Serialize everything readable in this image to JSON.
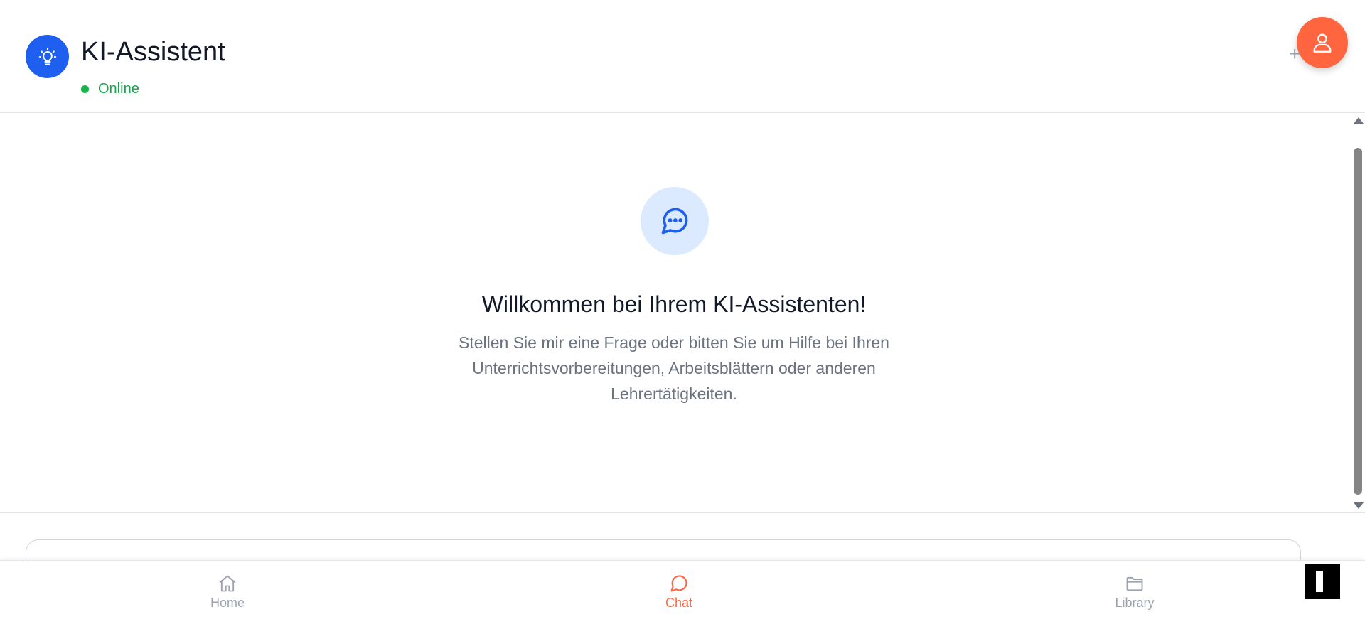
{
  "header": {
    "title": "KI-Assistent",
    "status": "Online",
    "plus_label": "+",
    "logo_icon": "lightbulb-icon",
    "profile_icon": "user-icon"
  },
  "colors": {
    "primary": "#1f5ff0",
    "accent": "#ff6640",
    "online": "#16a34a"
  },
  "chat": {
    "welcome_icon": "chat-bubble-icon",
    "welcome_title": "Willkommen bei Ihrem KI-Assistenten!",
    "welcome_text": "Stellen Sie mir eine Frage oder bitten Sie um Hilfe bei Ihren Unterrichtsvorbereitungen, Arbeitsblättern oder anderen Lehrertätigkeiten."
  },
  "input": {
    "placeholder": ""
  },
  "nav": {
    "home": "Home",
    "chat": "Chat",
    "library": "Library",
    "active": "chat"
  }
}
